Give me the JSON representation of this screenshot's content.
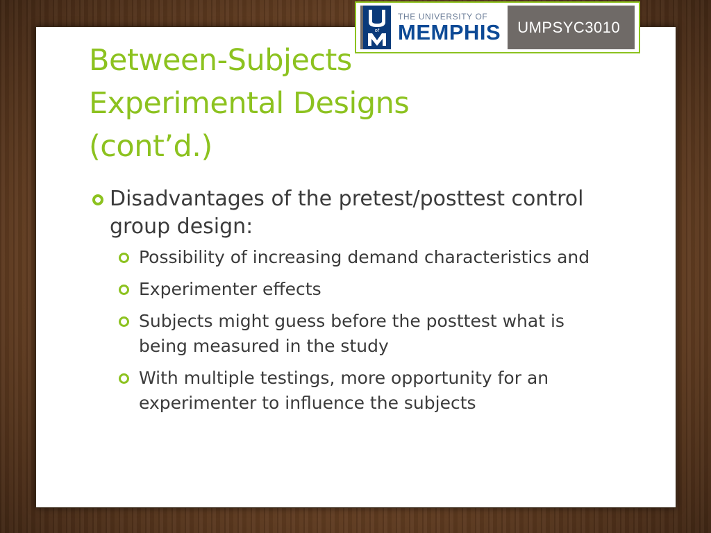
{
  "slide": {
    "title": "Between-Subjects\nExperimental Designs\n(cont’d.)",
    "logo": {
      "university_line": "THE UNIVERSITY OF",
      "name": "MEMPHIS",
      "mark_letters": "UM",
      "mark_small": "of",
      "course_code": "UMPSYC3010",
      "colors": {
        "navy": "#0d4a96",
        "gray": "#6f6a67",
        "border": "#8cc21f"
      }
    },
    "bullets": [
      {
        "text": "Disadvantages of the pretest/posttest control group design:",
        "sub": [
          {
            "text": "Possibility of increasing demand characteristics and"
          },
          {
            "text": "Experimenter effects"
          },
          {
            "text": "Subjects might guess before the posttest what is being measured in the study"
          },
          {
            "text": "With multiple testings, more opportunity for an experimenter to influence the subjects"
          }
        ]
      }
    ],
    "colors": {
      "accent": "#8cc21f",
      "body_text": "#3b3b3b",
      "background_wood": "#6b4325"
    }
  }
}
